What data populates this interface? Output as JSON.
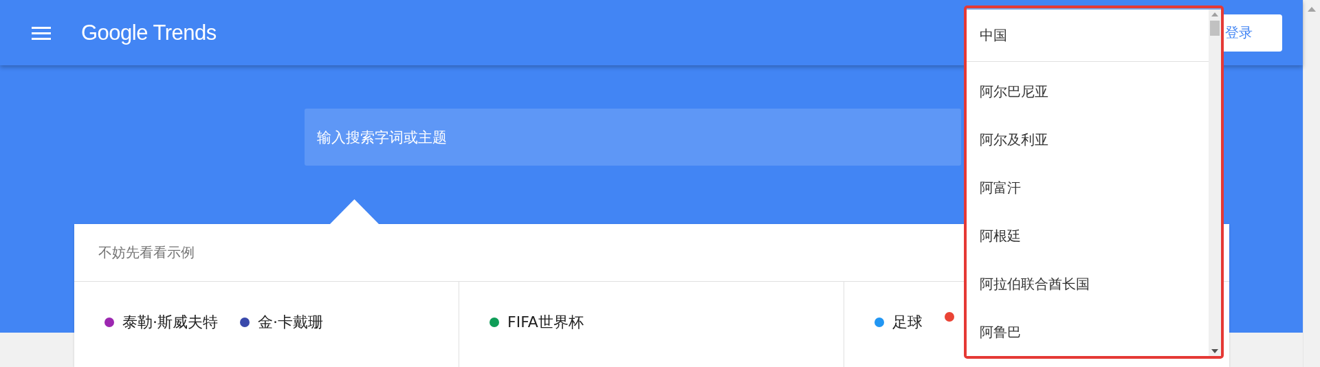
{
  "header": {
    "logo": "Google Trends",
    "login_button": "登录"
  },
  "search": {
    "placeholder": "输入搜索字词或主题"
  },
  "examples": {
    "heading": "不妨先看看示例",
    "columns": [
      {
        "items": [
          {
            "label": "泰勒·斯威夫特",
            "color": "#9c27b0"
          },
          {
            "label": "金·卡戴珊",
            "color": "#3949ab"
          }
        ]
      },
      {
        "items": [
          {
            "label": "FIFA世界杯",
            "color": "#0f9d58"
          }
        ]
      },
      {
        "items": [
          {
            "label": "足球",
            "color": "#2196f3"
          },
          {
            "color": "#ea4335"
          }
        ]
      }
    ]
  },
  "country_dropdown": {
    "items": [
      {
        "label": "中国",
        "kind": "pinned"
      },
      {
        "label": "阿尔巴尼亚",
        "kind": "option"
      },
      {
        "label": "阿尔及利亚",
        "kind": "option"
      },
      {
        "label": "阿富汗",
        "kind": "option"
      },
      {
        "label": "阿根廷",
        "kind": "option"
      },
      {
        "label": "阿拉伯联合酋长国",
        "kind": "option"
      },
      {
        "label": "阿鲁巴",
        "kind": "option"
      }
    ]
  }
}
